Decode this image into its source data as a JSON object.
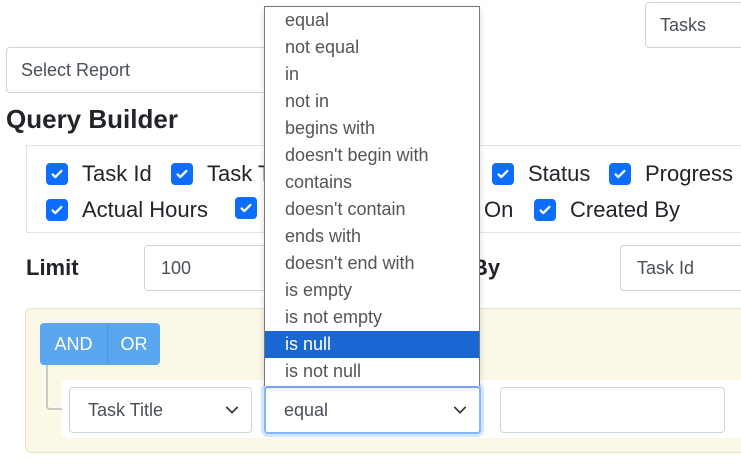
{
  "header": {
    "table_select": "Tasks",
    "report_select": "Select Report",
    "title": "Query Builder"
  },
  "columns": [
    {
      "label": "Task Id",
      "checked": true
    },
    {
      "label": "Task T",
      "checked": true
    },
    {
      "label": "Status",
      "checked": true
    },
    {
      "label": "Progress",
      "checked": true
    },
    {
      "label": "Actual Hours",
      "checked": true
    },
    {
      "label": "",
      "checked": true
    },
    {
      "label": "On",
      "checked": true
    },
    {
      "label": "Created By",
      "checked": true
    }
  ],
  "limit": {
    "label": "Limit",
    "value": "100",
    "order_label_partial": "By",
    "order_value": "Task Id"
  },
  "rules": {
    "and_label": "AND",
    "or_label": "OR",
    "field": "Task Title",
    "operator": "equal",
    "value": ""
  },
  "operator_options": {
    "items": [
      "equal",
      "not equal",
      "in",
      "not in",
      "begins with",
      "doesn't begin with",
      "contains",
      "doesn't contain",
      "ends with",
      "doesn't end with",
      "is empty",
      "is not empty",
      "is null",
      "is not null"
    ],
    "highlighted": "is null"
  },
  "colors": {
    "accent": "#0d6efd",
    "group_bg": "#fcf8e8",
    "button": "#5aa7f0",
    "highlight": "#1967d2"
  }
}
